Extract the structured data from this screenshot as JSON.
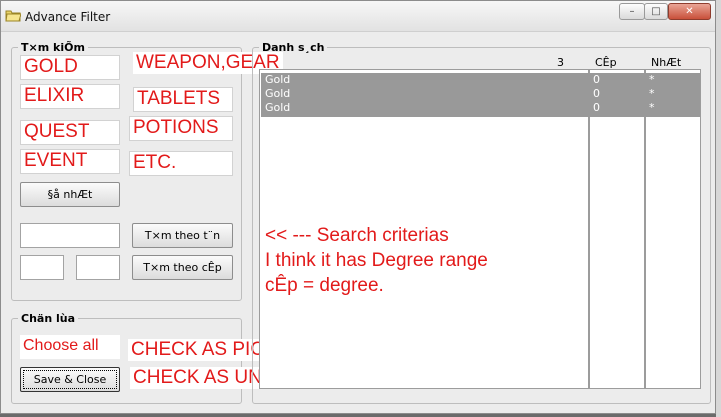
{
  "window": {
    "title": "Advance Filter",
    "controls": {
      "minimize": "–",
      "maximize": "□",
      "close": "✕"
    }
  },
  "search_group": {
    "legend": "T×m kiÕm",
    "categories": [
      "GOLD",
      "WEAPON,GEAR",
      "ELIXIR",
      "TABLETS",
      "QUEST",
      "POTIONS",
      "EVENT",
      "ETC."
    ],
    "update_button": "§å nhÆt",
    "name_input": "",
    "level_min_input": "",
    "level_max_input": "",
    "search_by_name_button": "T×m theo t¨n",
    "search_by_level_button": "T×m theo cÊp"
  },
  "select_group": {
    "legend": "Chän lùa",
    "choose_all": "Choose all",
    "save_close_button": "Save & Close",
    "note_pick": "CHECK AS PICK",
    "note_unpick": "CHECK AS UNPICK"
  },
  "list_group": {
    "legend": "Danh s¸ch",
    "columns": [
      "3",
      "CÊp",
      "NhÆt"
    ],
    "rows": [
      {
        "name": "Gold",
        "level": "0",
        "pick": "*"
      },
      {
        "name": "Gold",
        "level": "0",
        "pick": "*"
      },
      {
        "name": "Gold",
        "level": "0",
        "pick": "*"
      }
    ]
  },
  "annotations": [
    "<< --- Search criterias",
    "I think it has Degree range",
    "cÊp = degree."
  ],
  "colors": {
    "annotation": "#e21a1a",
    "selected_row": "#999999",
    "window_bg": "#ececec"
  }
}
